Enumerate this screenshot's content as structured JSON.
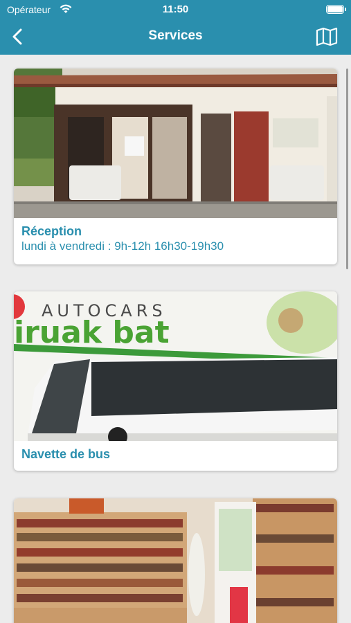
{
  "status_bar": {
    "carrier": "Opérateur",
    "time": "11:50",
    "icons": [
      "wifi-icon",
      "battery-icon"
    ]
  },
  "nav": {
    "title": "Services",
    "back_icon": "chevron-left-icon",
    "map_icon": "map-icon"
  },
  "colors": {
    "header": "#2a8fae",
    "accent": "#2a8fae",
    "background": "#ececec"
  },
  "services": [
    {
      "title": "Réception",
      "subtitle": "lundi à vendredi : 9h-12h  16h30-19h30"
    },
    {
      "title": "Navette de bus",
      "image_text": [
        "AUTOCARS",
        "iruak bat"
      ]
    },
    {
      "title": ""
    }
  ]
}
